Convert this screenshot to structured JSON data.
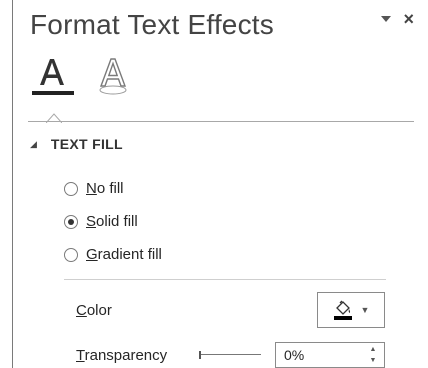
{
  "pane": {
    "title": "Format Text Effects",
    "menu_icon": "chevron-down-icon",
    "close_label": "×"
  },
  "tabs": [
    {
      "name": "text-fill-outline",
      "icon": "text-fill-icon",
      "selected": true
    },
    {
      "name": "text-effects",
      "icon": "text-effects-icon",
      "selected": false
    }
  ],
  "section": {
    "caret": "◢",
    "title": "TEXT FILL",
    "options": [
      {
        "mnemonic": "N",
        "rest": "o fill",
        "checked": false
      },
      {
        "mnemonic": "S",
        "rest": "olid fill",
        "checked": true
      },
      {
        "mnemonic": "G",
        "rest": "radient fill",
        "checked": false
      }
    ],
    "color": {
      "mnemonic": "C",
      "rest": "olor",
      "swatch": "#000000",
      "arrow": "▼"
    },
    "transparency": {
      "mnemonic": "T",
      "rest": "ransparency",
      "value": "0%",
      "level": 0,
      "up": "▲",
      "down": "▼"
    }
  },
  "colors": {
    "text": "#262626",
    "border": "#8a8a8a",
    "accent": "#333333"
  }
}
